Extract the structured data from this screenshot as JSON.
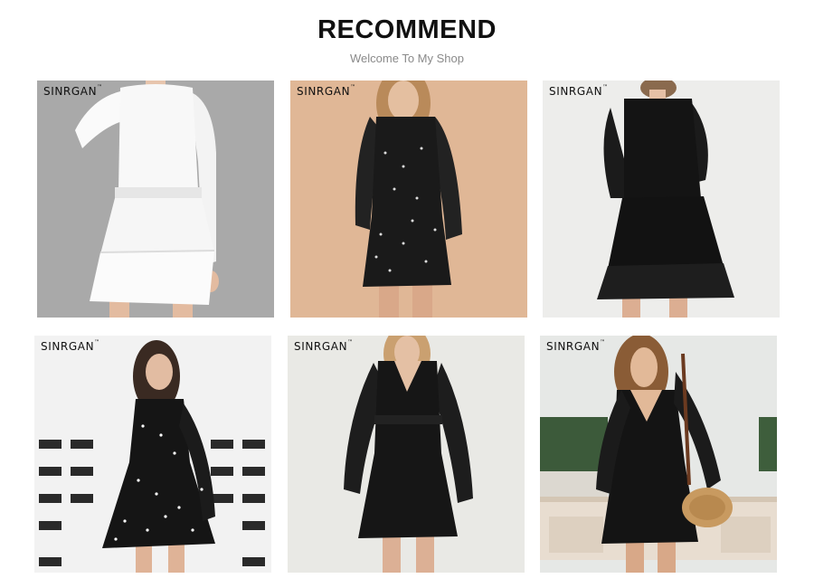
{
  "header": {
    "title": "RECOMMEND",
    "subtitle": "Welcome To My Shop"
  },
  "products": [
    {
      "brand": "SINRGAN",
      "tm": "™",
      "bg": "#a9a9a9",
      "dress": "#f7f7f7",
      "icon": "white-dress-photo"
    },
    {
      "brand": "SINRGAN",
      "tm": "™",
      "bg": "#e0b796",
      "dress": "#1a1a1a",
      "icon": "black-polka-dot-dress-photo"
    },
    {
      "brand": "SINRGAN",
      "tm": "™",
      "bg": "#ededeb",
      "dress": "#121212",
      "icon": "black-tiered-dress-photo"
    },
    {
      "brand": "SINRGAN",
      "tm": "™",
      "bg": "#f2f2f2",
      "dress": "#151515",
      "icon": "black-white-dot-wrap-dress-photo"
    },
    {
      "brand": "SINRGAN",
      "tm": "™",
      "bg": "#e9e9e5",
      "dress": "#161616",
      "icon": "black-v-neck-dress-photo"
    },
    {
      "brand": "SINRGAN",
      "tm": "™",
      "bg": "#e6e8e6",
      "dress": "#141414",
      "icon": "black-dress-with-bag-photo"
    }
  ]
}
